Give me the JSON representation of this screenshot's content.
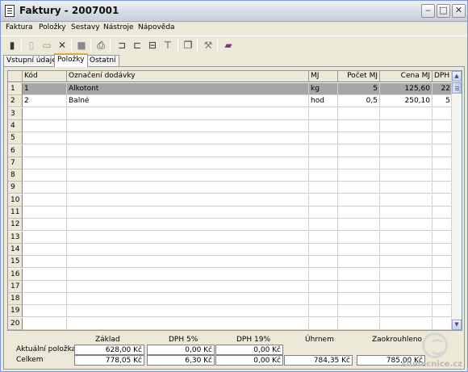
{
  "window": {
    "title": "Faktury - 2007001"
  },
  "menu": [
    "Faktura",
    "Položky",
    "Sestavy",
    "Nástroje",
    "Nápověda"
  ],
  "tabs": [
    {
      "label": "Vstupní údaje",
      "active": false
    },
    {
      "label": "Položky",
      "active": true
    },
    {
      "label": "Ostatní",
      "active": false
    }
  ],
  "grid": {
    "columns": [
      "Kód",
      "Označení dodávky",
      "MJ",
      "Počet MJ",
      "Cena MJ",
      "DPH"
    ],
    "rows": [
      {
        "n": "1",
        "kod": "1",
        "nazev": "Alkotont",
        "mj": "kg",
        "pocet": "5",
        "cena": "125,60",
        "dph": "22"
      },
      {
        "n": "2",
        "kod": "2",
        "nazev": "Balné",
        "mj": "hod",
        "pocet": "0,5",
        "cena": "250,10",
        "dph": "5"
      },
      {
        "n": "3"
      },
      {
        "n": "4"
      },
      {
        "n": "5"
      },
      {
        "n": "6"
      },
      {
        "n": "7"
      },
      {
        "n": "8"
      },
      {
        "n": "9"
      },
      {
        "n": "10"
      },
      {
        "n": "11"
      },
      {
        "n": "12"
      },
      {
        "n": "13"
      },
      {
        "n": "14"
      },
      {
        "n": "15"
      },
      {
        "n": "16"
      },
      {
        "n": "17"
      },
      {
        "n": "18"
      },
      {
        "n": "19"
      },
      {
        "n": "20"
      }
    ]
  },
  "summary": {
    "headers": {
      "zaklad": "Základ",
      "dph5": "DPH 5%",
      "dph19": "DPH 19%",
      "uhrnem": "Úhrnem",
      "zaokrouhleno": "Zaokrouhleno"
    },
    "aktualni": {
      "label": "Aktuální položka",
      "zaklad": "628,00 Kč",
      "dph5": "0,00 Kč",
      "dph19": "0,00 Kč"
    },
    "celkem": {
      "label": "Celkem",
      "zaklad": "778,05 Kč",
      "dph5": "6,30 Kč",
      "dph19": "0,00 Kč",
      "uhrnem": "784,35 Kč",
      "zaokrouhleno": "785,00 Kč"
    }
  },
  "watermark": "slunecnice.cz",
  "icons": [
    "window-doc-icon",
    "calculator-icon",
    "new-doc-icon",
    "open-folder-icon",
    "delete-x-icon",
    "stop-icon",
    "print-icon",
    "tool-a-icon",
    "tool-b-icon",
    "tool-c-icon",
    "tool-d-icon",
    "copy-icon",
    "hammer-icon",
    "book-icon"
  ]
}
